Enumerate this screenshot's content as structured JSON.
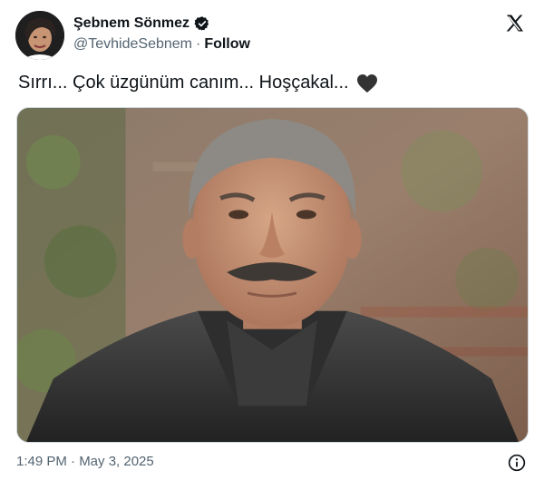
{
  "author": {
    "display_name": "Şebnem Sönmez",
    "handle": "@TevhideSebnem",
    "separator": "·",
    "follow_label": "Follow",
    "avatar_icon": "profile-photo",
    "verified_icon": "verified-badge-icon",
    "verified_color": "#1d9bf0"
  },
  "brand": {
    "logo_icon": "x-logo-icon"
  },
  "tweet": {
    "text": "Sırrı... Çok üzgünüm canım... Hoşçakal...",
    "emoji_icon": "black-heart-icon",
    "media_description_icon": "photo-of-man-in-leather-jacket"
  },
  "footer": {
    "timestamp": "1:49 PM · May 3, 2025",
    "info_icon": "info-icon"
  }
}
